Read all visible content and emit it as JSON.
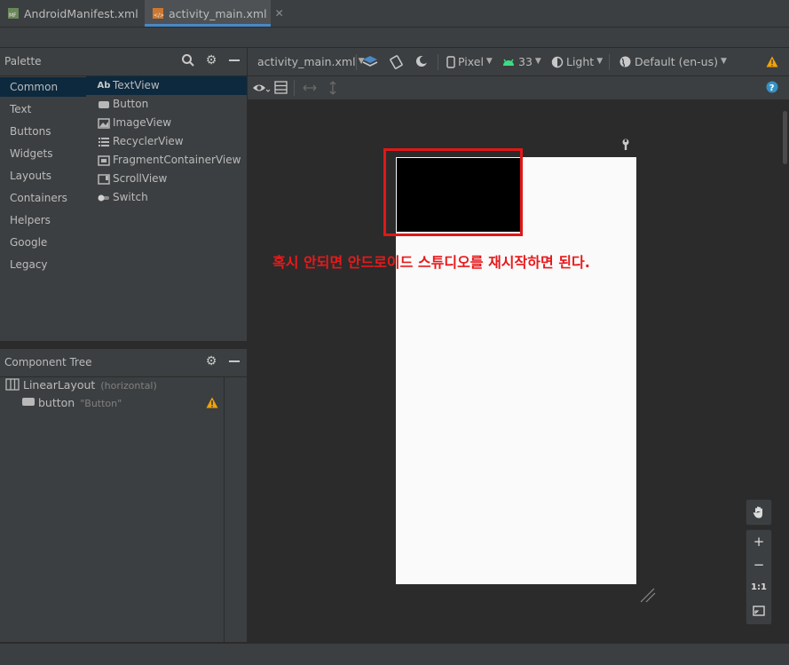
{
  "tabs": [
    {
      "label": "AndroidManifest.xml",
      "icon": "manifest-file-icon",
      "active": false
    },
    {
      "label": "activity_main.xml",
      "icon": "layout-file-icon",
      "active": true
    }
  ],
  "palette": {
    "title": "Palette",
    "categories": [
      "Common",
      "Text",
      "Buttons",
      "Widgets",
      "Layouts",
      "Containers",
      "Helpers",
      "Google",
      "Legacy"
    ],
    "selected_category": "Common",
    "items": [
      {
        "label": "TextView",
        "icon": "textview-icon",
        "glyph": "Ab"
      },
      {
        "label": "Button",
        "icon": "button-icon"
      },
      {
        "label": "ImageView",
        "icon": "imageview-icon"
      },
      {
        "label": "RecyclerView",
        "icon": "recyclerview-icon"
      },
      {
        "label": "FragmentContainerView",
        "icon": "fragment-container-icon"
      },
      {
        "label": "ScrollView",
        "icon": "scrollview-icon"
      },
      {
        "label": "Switch",
        "icon": "switch-icon"
      }
    ]
  },
  "component_tree": {
    "title": "Component Tree",
    "root": {
      "label": "LinearLayout",
      "detail": "(horizontal)"
    },
    "child": {
      "label": "button",
      "detail": "\"Button\"",
      "warning": true
    }
  },
  "toolbar": {
    "file": "activity_main.xml",
    "device": "Pixel",
    "api": "33",
    "theme": "Light",
    "locale": "Default (en-us)"
  },
  "annotation": "혹시 안되면 안드로이드 스튜디오를 재시작하면 된다.",
  "zoom": {
    "in": "+",
    "out": "−",
    "one_to_one": "1:1"
  },
  "colors": {
    "accent": "#4a88c7",
    "annotation": "#e8191b",
    "warning": "#f0a30a",
    "selection": "#0d293e"
  }
}
